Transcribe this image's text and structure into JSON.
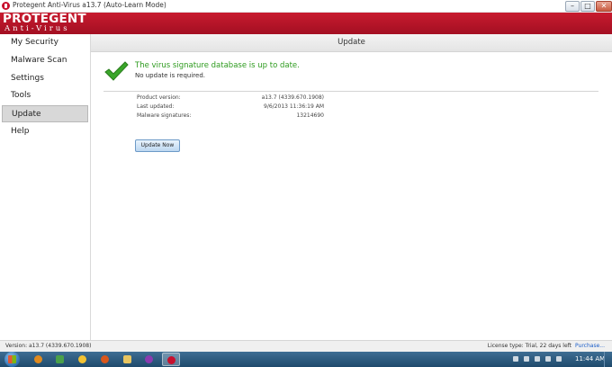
{
  "window": {
    "title": "Protegent Anti-Virus a13.7 (Auto-Learn Mode)",
    "controls": {
      "minimize": "–",
      "maximize": "□",
      "close": "✕"
    }
  },
  "brand": {
    "logo_main": "PROTEGENT",
    "logo_sub": "Anti-Virus"
  },
  "sidebar": {
    "items": [
      {
        "label": "My Security",
        "active": false
      },
      {
        "label": "Malware Scan",
        "active": false
      },
      {
        "label": "Settings",
        "active": false
      },
      {
        "label": "Tools",
        "active": false
      },
      {
        "label": "Update",
        "active": true
      },
      {
        "label": "Help",
        "active": false
      }
    ]
  },
  "main": {
    "header": "Update",
    "status_title": "The virus signature database is up to date.",
    "status_sub": "No update is required.",
    "info": [
      {
        "label": "Product version:",
        "value": "a13.7 (4339.670.1908)"
      },
      {
        "label": "Last updated:",
        "value": "9/6/2013 11:36:19 AM"
      },
      {
        "label": "Malware signatures:",
        "value": "13214690"
      }
    ],
    "update_button": "Update Now"
  },
  "statusbar": {
    "version": "Version: a13.7 (4339.670.1908)",
    "license": "License type: Trial, 22 days left",
    "purchase": "Purchase..."
  },
  "taskbar": {
    "apps": [
      {
        "icon": "media-player-icon",
        "color": "#e08a1e"
      },
      {
        "icon": "recycle-icon",
        "color": "#4aa04a"
      },
      {
        "icon": "smiley-icon",
        "color": "#f2c232"
      },
      {
        "icon": "firefox-icon",
        "color": "#d9571c"
      },
      {
        "icon": "folder-icon",
        "color": "#e8c560"
      },
      {
        "icon": "purple-app-icon",
        "color": "#8a3bb0"
      },
      {
        "icon": "protegent-icon",
        "color": "#c8102e"
      }
    ],
    "clock": "11:44 AM"
  },
  "colors": {
    "brand_red": "#c81b2f",
    "status_green": "#2e9b1f",
    "link_blue": "#1a5cc8"
  }
}
